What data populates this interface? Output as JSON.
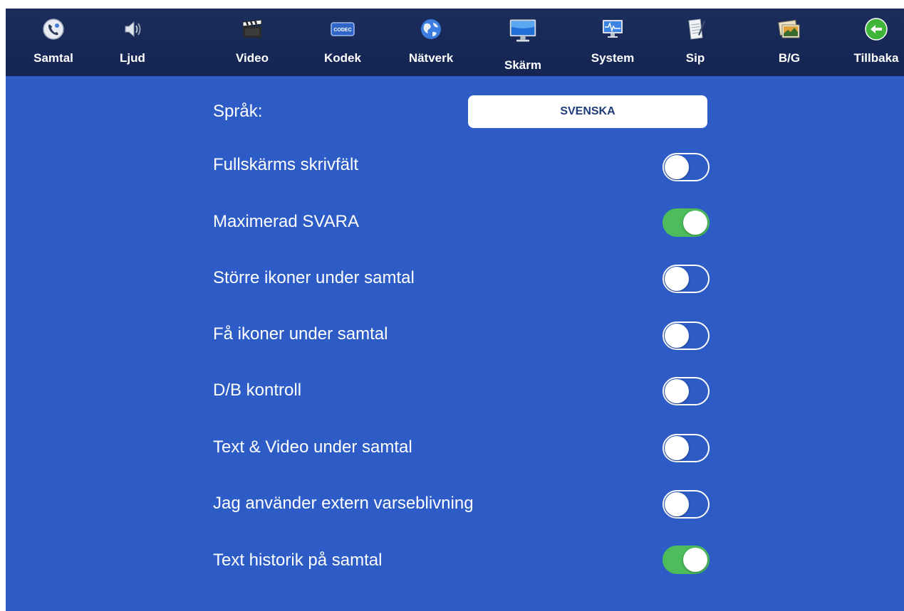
{
  "toolbar": {
    "items": [
      {
        "label": "Samtal",
        "icon": "phone-settings-icon"
      },
      {
        "label": "Ljud",
        "icon": "speaker-icon"
      },
      {
        "label": "Video",
        "icon": "clapperboard-icon"
      },
      {
        "label": "Kodek",
        "icon": "codec-icon"
      },
      {
        "label": "Nätverk",
        "icon": "globe-icon"
      },
      {
        "label": "Skärm",
        "icon": "monitor-icon",
        "active": true
      },
      {
        "label": "System",
        "icon": "system-monitor-icon"
      },
      {
        "label": "Sip",
        "icon": "notepad-icon"
      },
      {
        "label": "B/G",
        "icon": "picture-icon"
      },
      {
        "label": "Tillbaka",
        "icon": "back-arrow-icon"
      }
    ],
    "codec_icon_text": "CODEC"
  },
  "settings": {
    "language_label": "Språk:",
    "language_value": "SVENSKA",
    "rows": [
      {
        "label": "Fullskärms skrivfält",
        "on": false
      },
      {
        "label": "Maximerad SVARA",
        "on": true
      },
      {
        "label": "Större ikoner under samtal",
        "on": false
      },
      {
        "label": "Få ikoner under samtal",
        "on": false
      },
      {
        "label": "D/B kontroll",
        "on": false
      },
      {
        "label": "Text & Video under samtal",
        "on": false
      },
      {
        "label": "Jag använder extern varseblivning",
        "on": false
      },
      {
        "label": "Text historik på samtal",
        "on": true
      }
    ]
  },
  "colors": {
    "background": "#2d5cc6",
    "toolbar": "#142552",
    "toggle_on": "#4cbd5a",
    "toggle_off_border": "#ffffff"
  }
}
